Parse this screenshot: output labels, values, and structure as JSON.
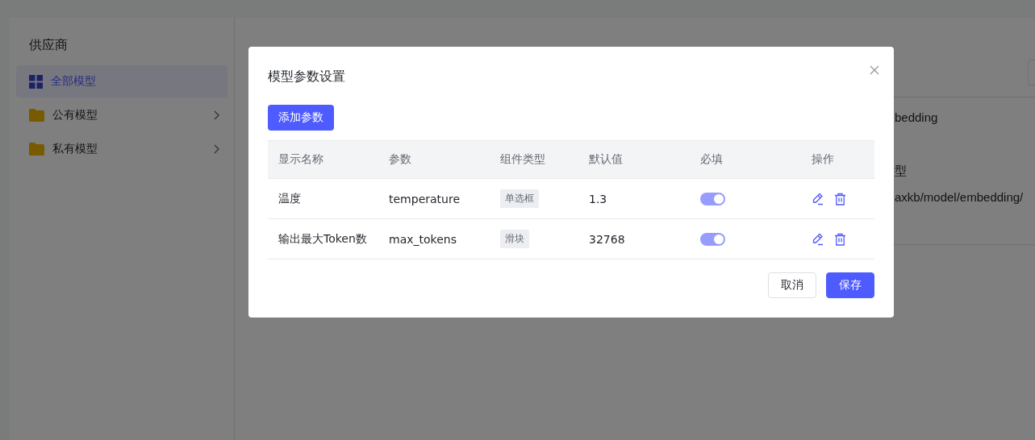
{
  "sidebar": {
    "title": "供应商",
    "items": [
      {
        "label": "全部模型",
        "kind": "grid",
        "selected": true,
        "has_arrow": false
      },
      {
        "label": "公有模型",
        "kind": "folder",
        "selected": false,
        "has_arrow": true
      },
      {
        "label": "私有模型",
        "kind": "folder",
        "selected": false,
        "has_arrow": true
      }
    ]
  },
  "main": {
    "card_texts": [
      "bedding",
      "型",
      "axkb/model/embedding/"
    ]
  },
  "dialog": {
    "title": "模型参数设置",
    "add_button": "添加参数",
    "columns": [
      "显示名称",
      "参数",
      "组件类型",
      "默认值",
      "必填",
      "操作"
    ],
    "rows": [
      {
        "name": "温度",
        "param": "temperature",
        "component": "单选框",
        "default": "1.3",
        "required": true,
        "required_disabled": true
      },
      {
        "name": "输出最大Token数",
        "param": "max_tokens",
        "component": "滑块",
        "default": "32768",
        "required": true,
        "required_disabled": true
      }
    ],
    "buttons": [
      {
        "label": "取消",
        "kind": "default"
      },
      {
        "label": "保存",
        "kind": "primary"
      }
    ]
  }
}
